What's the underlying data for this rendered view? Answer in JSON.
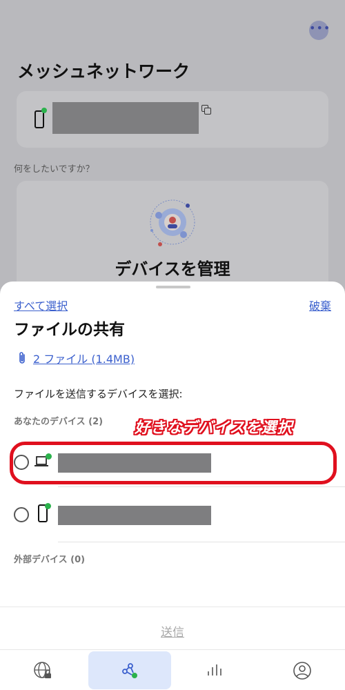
{
  "background": {
    "title": "メッシュネットワーク",
    "question": "何をしたいですか？",
    "manage_label": "デバイスを管理"
  },
  "sheet": {
    "select_all": "すべて選択",
    "discard": "破棄",
    "title": "ファイルの共有",
    "files_link": "2 ファイル (1.4MB)",
    "instruction": "ファイルを送信するデバイスを選択:",
    "your_devices_label": "あなたのデバイス (2)",
    "external_devices_label": "外部デバイス (0)",
    "annotation": "好きなデバイスを選択",
    "send_label": "送信"
  },
  "devices": [
    {
      "type": "laptop-icon",
      "online": true,
      "selected": false
    },
    {
      "type": "phone-icon",
      "online": true,
      "selected": false
    }
  ],
  "nav": {
    "items": [
      {
        "icon": "globe-lock-icon",
        "active": false
      },
      {
        "icon": "mesh-share-icon",
        "active": true
      },
      {
        "icon": "stats-bars-icon",
        "active": false
      },
      {
        "icon": "profile-icon",
        "active": false
      }
    ]
  },
  "colors": {
    "accent": "#3a5fcd",
    "annotation": "#e0101e",
    "online": "#2bb24c",
    "nav_active_bg": "#dde7fb"
  }
}
